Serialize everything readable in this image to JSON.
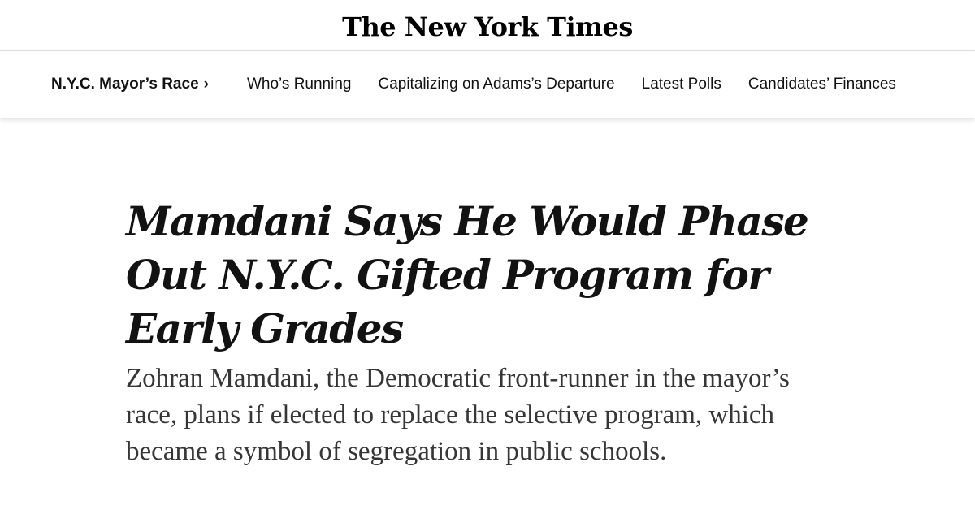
{
  "masthead": {
    "logo_text": "The New York Times"
  },
  "subnav": {
    "section_label": "N.Y.C. Mayor’s Race",
    "chevron": "›",
    "links": [
      "Who’s Running",
      "Capitalizing on Adams’s Departure",
      "Latest Polls",
      "Candidates’ Finances"
    ]
  },
  "article": {
    "headline": "Mamdani Says He Would Phase Out N.Y.C. Gifted Program for Early Grades",
    "summary": "Zohran Mamdani, the Democratic front-runner in the mayor’s race, plans if elected to replace the selective program, which became a symbol of segregation in public schools."
  }
}
